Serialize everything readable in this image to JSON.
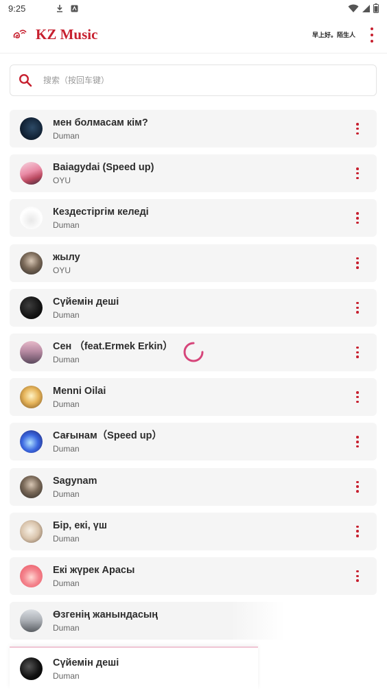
{
  "status": {
    "time": "9:25"
  },
  "app": {
    "title": "KZ Music",
    "greeting": "早上好。陌生人",
    "accent": "#c7202f"
  },
  "search": {
    "placeholder": "搜索（按回车键）"
  },
  "songs": [
    {
      "title": "мен болмасам кім?",
      "artist": "Duman",
      "cover": "dark-night"
    },
    {
      "title": "Baiagydai (Speed up)",
      "artist": "OYU",
      "cover": "pink-sunset"
    },
    {
      "title": "Кездестіргім келеді",
      "artist": "Duman",
      "cover": "white-sketch"
    },
    {
      "title": "жылу",
      "artist": "OYU",
      "cover": "portrait-photo"
    },
    {
      "title": "Сүйемін деші",
      "artist": "Duman",
      "cover": "dark-sparkle"
    },
    {
      "title": "Сен （feat.Ermek Erkin）",
      "artist": "Duman",
      "cover": "couple-photo"
    },
    {
      "title": "Menni Oilai",
      "artist": "Duman",
      "cover": "golden-portrait"
    },
    {
      "title": "Сағынам（Speed up）",
      "artist": "Duman",
      "cover": "blue-glow"
    },
    {
      "title": "Sagynam",
      "artist": "Duman",
      "cover": "portrait-photo"
    },
    {
      "title": "Бір, екі, үш",
      "artist": "Duman",
      "cover": "light-portrait"
    },
    {
      "title": "Екі жүрек Арасы",
      "artist": "Duman",
      "cover": "pink-heart"
    },
    {
      "title": "Өзгенің жанындасың",
      "artist": "Duman",
      "cover": "grey-landscape"
    }
  ],
  "now_playing": {
    "title": "Сүйемін деші",
    "artist": "Duman",
    "cover": "dark-sparkle"
  }
}
